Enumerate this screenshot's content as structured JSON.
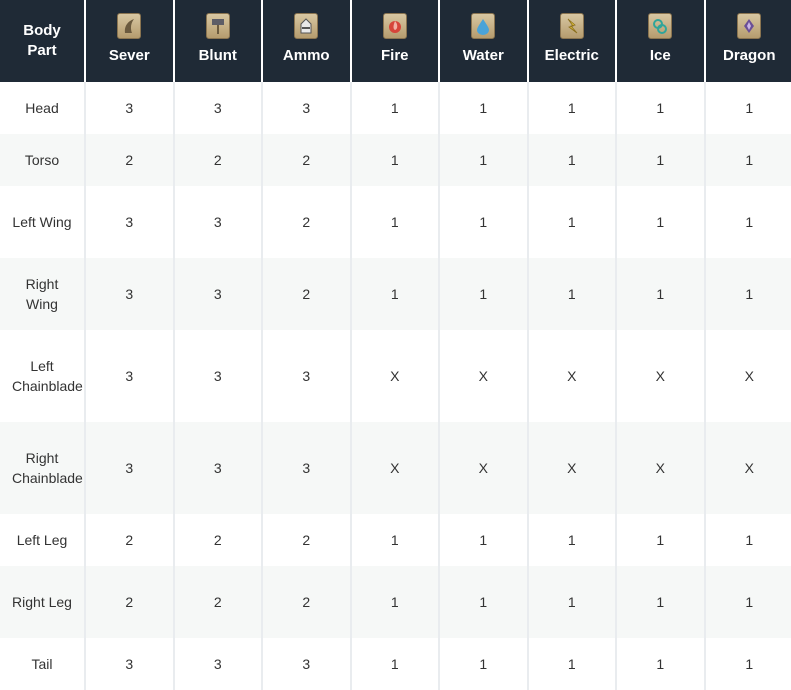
{
  "header": {
    "body_part": [
      "Body",
      "Part"
    ],
    "columns": [
      {
        "label": "Sever",
        "icon": "sever-icon"
      },
      {
        "label": "Blunt",
        "icon": "blunt-icon"
      },
      {
        "label": "Ammo",
        "icon": "ammo-icon"
      },
      {
        "label": "Fire",
        "icon": "fire-icon"
      },
      {
        "label": "Water",
        "icon": "water-icon"
      },
      {
        "label": "Electric",
        "icon": "electric-icon"
      },
      {
        "label": "Ice",
        "icon": "ice-icon"
      },
      {
        "label": "Dragon",
        "icon": "dragon-icon"
      }
    ]
  },
  "rows": [
    {
      "part": "Head",
      "values": [
        "3",
        "3",
        "3",
        "1",
        "1",
        "1",
        "1",
        "1"
      ]
    },
    {
      "part": "Torso",
      "values": [
        "2",
        "2",
        "2",
        "1",
        "1",
        "1",
        "1",
        "1"
      ]
    },
    {
      "part": "Left Wing",
      "values": [
        "3",
        "3",
        "2",
        "1",
        "1",
        "1",
        "1",
        "1"
      ]
    },
    {
      "part": "Right Wing",
      "values": [
        "3",
        "3",
        "2",
        "1",
        "1",
        "1",
        "1",
        "1"
      ]
    },
    {
      "part": "Left Chainblade",
      "values": [
        "3",
        "3",
        "3",
        "X",
        "X",
        "X",
        "X",
        "X"
      ]
    },
    {
      "part": "Right Chainblade",
      "values": [
        "3",
        "3",
        "3",
        "X",
        "X",
        "X",
        "X",
        "X"
      ]
    },
    {
      "part": "Left Leg",
      "values": [
        "2",
        "2",
        "2",
        "1",
        "1",
        "1",
        "1",
        "1"
      ]
    },
    {
      "part": "Right Leg",
      "values": [
        "2",
        "2",
        "2",
        "1",
        "1",
        "1",
        "1",
        "1"
      ]
    },
    {
      "part": "Tail",
      "values": [
        "3",
        "3",
        "3",
        "1",
        "1",
        "1",
        "1",
        "1"
      ]
    }
  ],
  "colors": {
    "header_bg": "#1f2a36",
    "row_alt_bg": "#f6f8f7"
  }
}
